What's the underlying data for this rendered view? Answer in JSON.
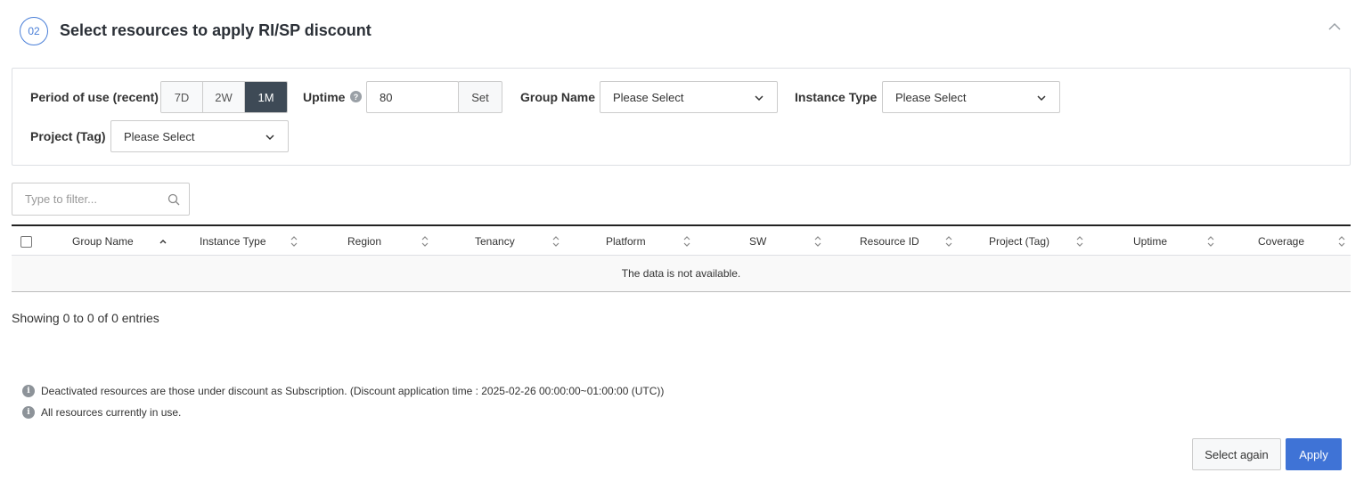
{
  "header": {
    "step": "02",
    "title": "Select resources to apply RI/SP discount"
  },
  "filters": {
    "period_label": "Period of use (recent)",
    "period_options": [
      "7D",
      "2W",
      "1M"
    ],
    "period_selected": "1M",
    "uptime_label": "Uptime",
    "uptime_value": "80",
    "set_label": "Set",
    "group_name_label": "Group Name",
    "group_name_value": "Please Select",
    "instance_type_label": "Instance Type",
    "instance_type_value": "Please Select",
    "project_tag_label": "Project (Tag)",
    "project_tag_value": "Please Select"
  },
  "search": {
    "placeholder": "Type to filter..."
  },
  "table": {
    "columns": [
      "Group Name",
      "Instance Type",
      "Region",
      "Tenancy",
      "Platform",
      "SW",
      "Resource ID",
      "Project (Tag)",
      "Uptime",
      "Coverage"
    ],
    "empty_message": "The data is not available.",
    "entries_text": "Showing 0 to 0 of 0 entries"
  },
  "notes": [
    "Deactivated resources are those under discount as Subscription. (Discount application time : 2025-02-26 00:00:00~01:00:00 (UTC))",
    "All resources currently in use."
  ],
  "actions": {
    "select_again": "Select again",
    "apply": "Apply"
  },
  "colors": {
    "accent": "#3f73d6",
    "active_segment": "#3e4a56"
  }
}
